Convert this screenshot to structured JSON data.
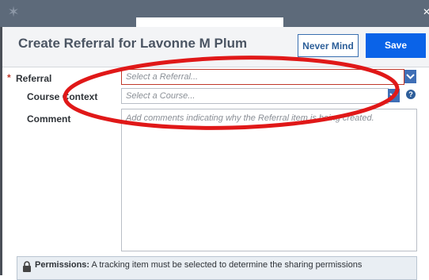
{
  "dialog": {
    "title": "Create Referral for Lavonne M Plum",
    "never_mind_label": "Never Mind",
    "save_label": "Save"
  },
  "form": {
    "referral": {
      "label": "Referral",
      "placeholder": "Select a Referral..."
    },
    "course_context": {
      "label": "Course Context",
      "placeholder": "Select a Course..."
    },
    "comment": {
      "label": "Comment",
      "placeholder": "Add comments indicating why the Referral item is being created."
    }
  },
  "permissions": {
    "label": "Permissions:",
    "text": "A tracking item must be selected to determine the sharing permissions"
  },
  "colors": {
    "save": "#0a63e8",
    "annotation": "#e01818",
    "titlebar": "#5d6a7a"
  },
  "icons": [
    "star-logo-icon",
    "close-icon",
    "chevron-down-icon",
    "help-icon",
    "lock-icon"
  ]
}
